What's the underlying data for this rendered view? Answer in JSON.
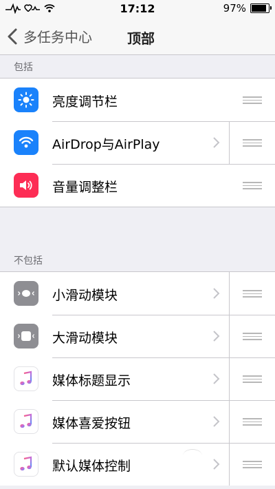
{
  "status_bar": {
    "time": "17:12",
    "battery_text": "97%",
    "battery_level": 0.97,
    "icons": [
      "heartbeat-icon",
      "wifi-icon",
      "battery-icon"
    ]
  },
  "nav": {
    "back_label": "多任务中心",
    "title": "顶部"
  },
  "sections": [
    {
      "header": "包括",
      "items": [
        {
          "label": "亮度调节栏",
          "icon": "brightness-icon",
          "color": "#1a82fb",
          "has_chevron": false
        },
        {
          "label": "AirDrop与AirPlay",
          "icon": "airdrop-icon",
          "color": "#1a82fb",
          "has_chevron": true
        },
        {
          "label": "音量调整栏",
          "icon": "volume-icon",
          "color": "#fd2d55",
          "has_chevron": false
        }
      ]
    },
    {
      "header": "不包括",
      "items": [
        {
          "label": "小滑动模块",
          "icon": "small-slider-icon",
          "color": "#8e8e93",
          "has_chevron": true
        },
        {
          "label": "大滑动模块",
          "icon": "large-slider-icon",
          "color": "#8e8e93",
          "has_chevron": true
        },
        {
          "label": "媒体标题显示",
          "icon": "music-icon",
          "color": "#ffffff",
          "has_chevron": true
        },
        {
          "label": "媒体喜爱按钮",
          "icon": "music-icon",
          "color": "#ffffff",
          "has_chevron": true
        },
        {
          "label": "默认媒体控制",
          "icon": "music-icon",
          "color": "#ffffff",
          "has_chevron": true
        }
      ]
    }
  ]
}
